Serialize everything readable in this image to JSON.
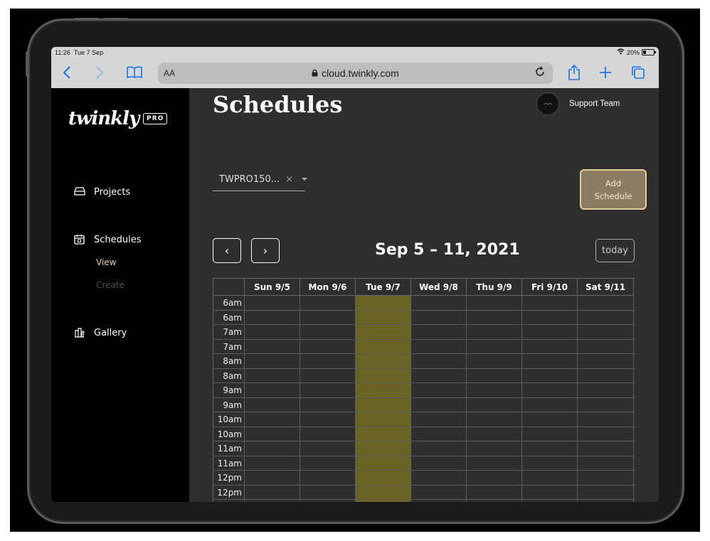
{
  "status": {
    "time": "11:26",
    "date": "Tue 7 Sep",
    "battery": "20%"
  },
  "browser": {
    "aa_label": "AA",
    "url": "cloud.twinkly.com"
  },
  "sidebar": {
    "logo_text": "twinkly",
    "logo_badge": "PRO",
    "items": [
      {
        "label": "Projects"
      },
      {
        "label": "Schedules",
        "sub": [
          {
            "label": "View"
          },
          {
            "label": "Create"
          }
        ]
      },
      {
        "label": "Gallery"
      }
    ]
  },
  "header": {
    "title": "Schedules",
    "user": "Support Team"
  },
  "toolbar": {
    "device": "TWPRO150...",
    "device_clear": "×",
    "add_label_line1": "Add",
    "add_label_line2": "Schedule"
  },
  "calendar": {
    "prev": "‹",
    "next": "›",
    "range": "Sep 5 – 11, 2021",
    "today_label": "today",
    "days": [
      "Sun 9/5",
      "Mon 9/6",
      "Tue 9/7",
      "Wed 9/8",
      "Thu 9/9",
      "Fri 9/10",
      "Sat 9/11"
    ],
    "highlight_day_index": 2,
    "times": [
      "6am",
      "6am",
      "7am",
      "7am",
      "8am",
      "8am",
      "9am",
      "9am",
      "10am",
      "10am",
      "11am",
      "11am",
      "12pm",
      "12pm"
    ]
  },
  "colors": {
    "accent_button": "#8b7d63",
    "today_column": "#6a6426",
    "safari_blue": "#1a73e8"
  }
}
